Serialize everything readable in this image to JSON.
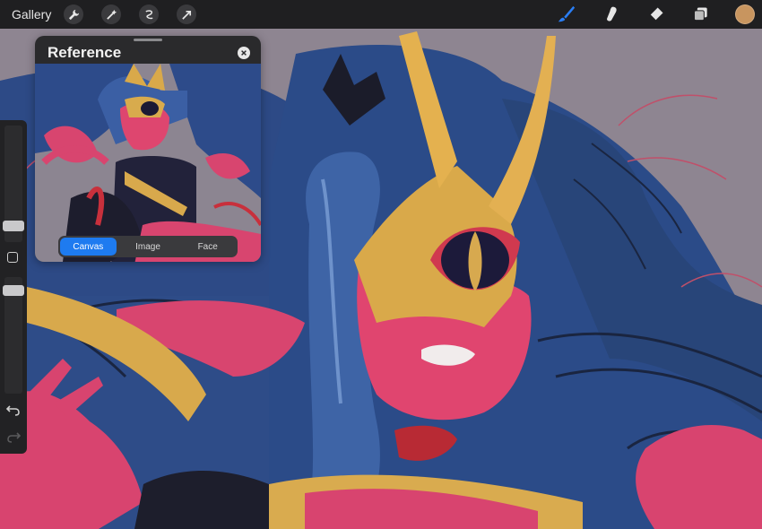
{
  "app": {
    "gallery_label": "Gallery",
    "tools_left": [
      "wrench-icon",
      "magic-wand-icon",
      "selection-icon",
      "transform-arrow-icon"
    ],
    "tools_right": [
      "brush-icon",
      "smudge-icon",
      "eraser-icon",
      "layers-icon"
    ],
    "current_color": "#c8955f",
    "active_tool_color": "#2a7ef5"
  },
  "reference": {
    "title": "Reference",
    "tabs": [
      {
        "label": "Canvas",
        "active": true
      },
      {
        "label": "Image",
        "active": false
      },
      {
        "label": "Face",
        "active": false
      }
    ]
  }
}
